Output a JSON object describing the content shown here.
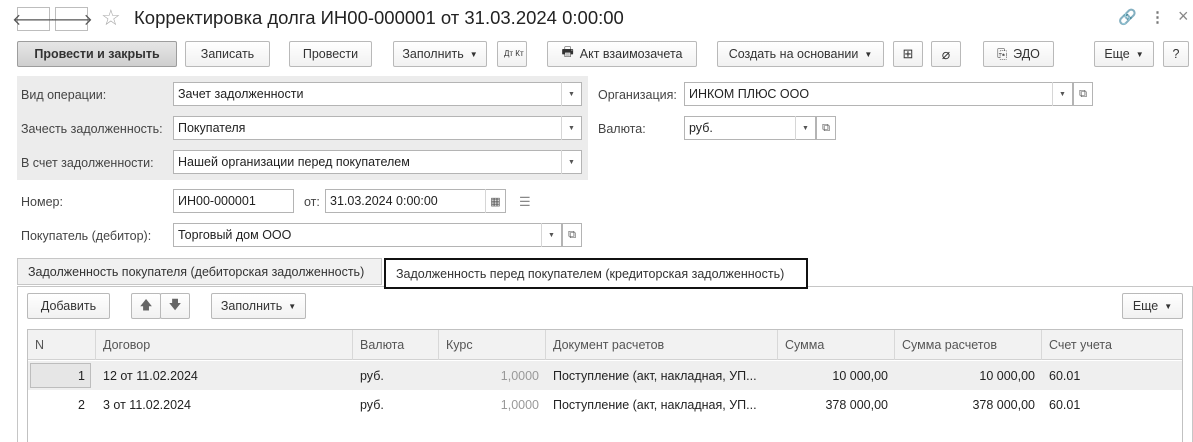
{
  "window": {
    "title": "Корректировка долга ИН00-000001 от 31.03.2024 0:00:00",
    "back_glyph": "🡐",
    "forward_glyph": "🡒",
    "star_glyph": "☆",
    "link_glyph": "🔗",
    "more_glyph": "⋮",
    "close_glyph": "×"
  },
  "toolbar": {
    "post_close": "Провести и закрыть",
    "save": "Записать",
    "post": "Провести",
    "fill": "Заполнить",
    "dtkt": "Дт Кт",
    "act": "Акт взаимозачета",
    "create_based": "Создать на основании",
    "edo": "ЭДО",
    "more": "Еще",
    "help": "?"
  },
  "form": {
    "op_type": {
      "label": "Вид операции:",
      "value": "Зачет задолженности"
    },
    "offset_debt": {
      "label": "Зачесть задолженность:",
      "value": "Покупателя"
    },
    "against_debt": {
      "label": "В счет задолженности:",
      "value": "Нашей организации перед покупателем"
    },
    "org": {
      "label": "Организация:",
      "value": "ИНКОМ ПЛЮС ООО"
    },
    "currency": {
      "label": "Валюта:",
      "value": "руб."
    },
    "number": {
      "label": "Номер:",
      "value": "ИН00-000001"
    },
    "date": {
      "label": "от:",
      "value": "31.03.2024  0:00:00"
    },
    "buyer": {
      "label": "Покупатель (дебитор):",
      "value": "Торговый дом ООО"
    }
  },
  "tabs": [
    {
      "label": "Задолженность покупателя (дебиторская задолженность)",
      "active": false
    },
    {
      "label": "Задолженность перед покупателем (кредиторская задолженность)",
      "active": true
    }
  ],
  "tab_toolbar": {
    "add": "Добавить",
    "up": "🡅",
    "down": "🡇",
    "fill": "Заполнить",
    "more": "Еще"
  },
  "table": {
    "columns": [
      "N",
      "Договор",
      "Валюта",
      "Курс",
      "Документ расчетов",
      "Сумма",
      "Сумма расчетов",
      "Счет учета"
    ],
    "rows": [
      [
        "1",
        "12 от 11.02.2024",
        "руб.",
        "1,0000",
        "Поступление (акт, накладная, УП...",
        "10 000,00",
        "10 000,00",
        "60.01"
      ],
      [
        "2",
        "3 от 11.02.2024",
        "руб.",
        "1,0000",
        "Поступление (акт, накладная, УП...",
        "378 000,00",
        "378 000,00",
        "60.01"
      ]
    ]
  }
}
